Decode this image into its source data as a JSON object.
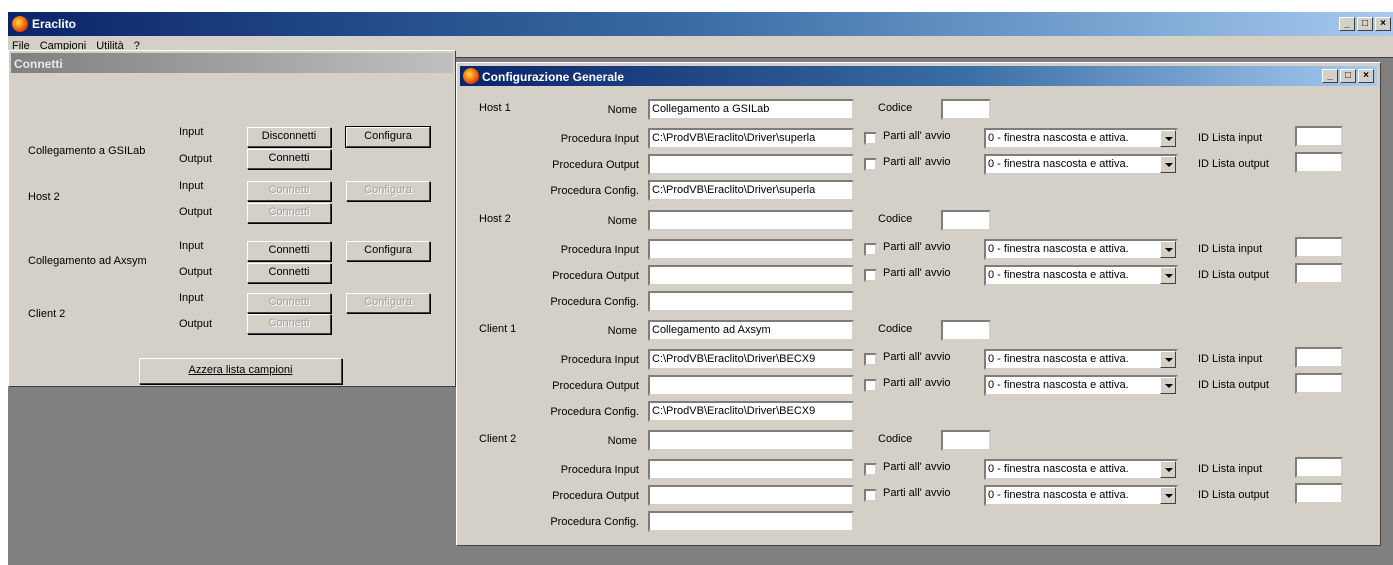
{
  "app": {
    "title": "Eraclito",
    "window_controls": [
      "_",
      "□",
      "×"
    ]
  },
  "menu": [
    "File",
    "Campioni",
    "Utilità",
    "?"
  ],
  "connetti": {
    "title": "Connetti",
    "io_labels": {
      "input": "Input",
      "output": "Output"
    },
    "groups": [
      {
        "name": "Collegamento a GSILab",
        "input_btn": "Disconnetti",
        "output_btn": "Connetti",
        "config_btn": "Configura",
        "enabled": true
      },
      {
        "name": "Host 2",
        "input_btn": "Connetti",
        "output_btn": "Connetti",
        "config_btn": "Configura",
        "enabled": false
      },
      {
        "name": "Collegamento ad Axsym",
        "input_btn": "Connetti",
        "output_btn": "Connetti",
        "config_btn": "Configura",
        "enabled": true
      },
      {
        "name": "Client 2",
        "input_btn": "Connetti",
        "output_btn": "Connetti",
        "config_btn": "Configura",
        "enabled": false
      }
    ],
    "reset_button": "Azzera lista campioni"
  },
  "config": {
    "title": "Configurazione Generale",
    "labels": {
      "nome": "Nome",
      "codice": "Codice",
      "proc_input": "Procedura Input",
      "proc_output": "Procedura Output",
      "proc_config": "Procedura Config.",
      "parti": "Parti all' avvio",
      "id_input": "ID Lista input",
      "id_output": "ID Lista output"
    },
    "combo_default": "0 - finestra nascosta e attiva.",
    "sections": [
      {
        "name": "Host 1",
        "nome": "Collegamento a GSILab",
        "codice": "",
        "proc_input": "C:\\ProdVB\\Eraclito\\Driver\\superla",
        "proc_output": "",
        "proc_config": "C:\\ProdVB\\Eraclito\\Driver\\superla",
        "id_input": "",
        "id_output": ""
      },
      {
        "name": "Host 2",
        "nome": "",
        "codice": "",
        "proc_input": "",
        "proc_output": "",
        "proc_config": "",
        "id_input": "",
        "id_output": ""
      },
      {
        "name": "Client 1",
        "nome": "Collegamento ad Axsym",
        "codice": "",
        "proc_input": "C:\\ProdVB\\Eraclito\\Driver\\BECX9",
        "proc_output": "",
        "proc_config": "C:\\ProdVB\\Eraclito\\Driver\\BECX9",
        "id_input": "",
        "id_output": ""
      },
      {
        "name": "Client 2",
        "nome": "",
        "codice": "",
        "proc_input": "",
        "proc_output": "",
        "proc_config": "",
        "id_input": "",
        "id_output": ""
      }
    ]
  }
}
